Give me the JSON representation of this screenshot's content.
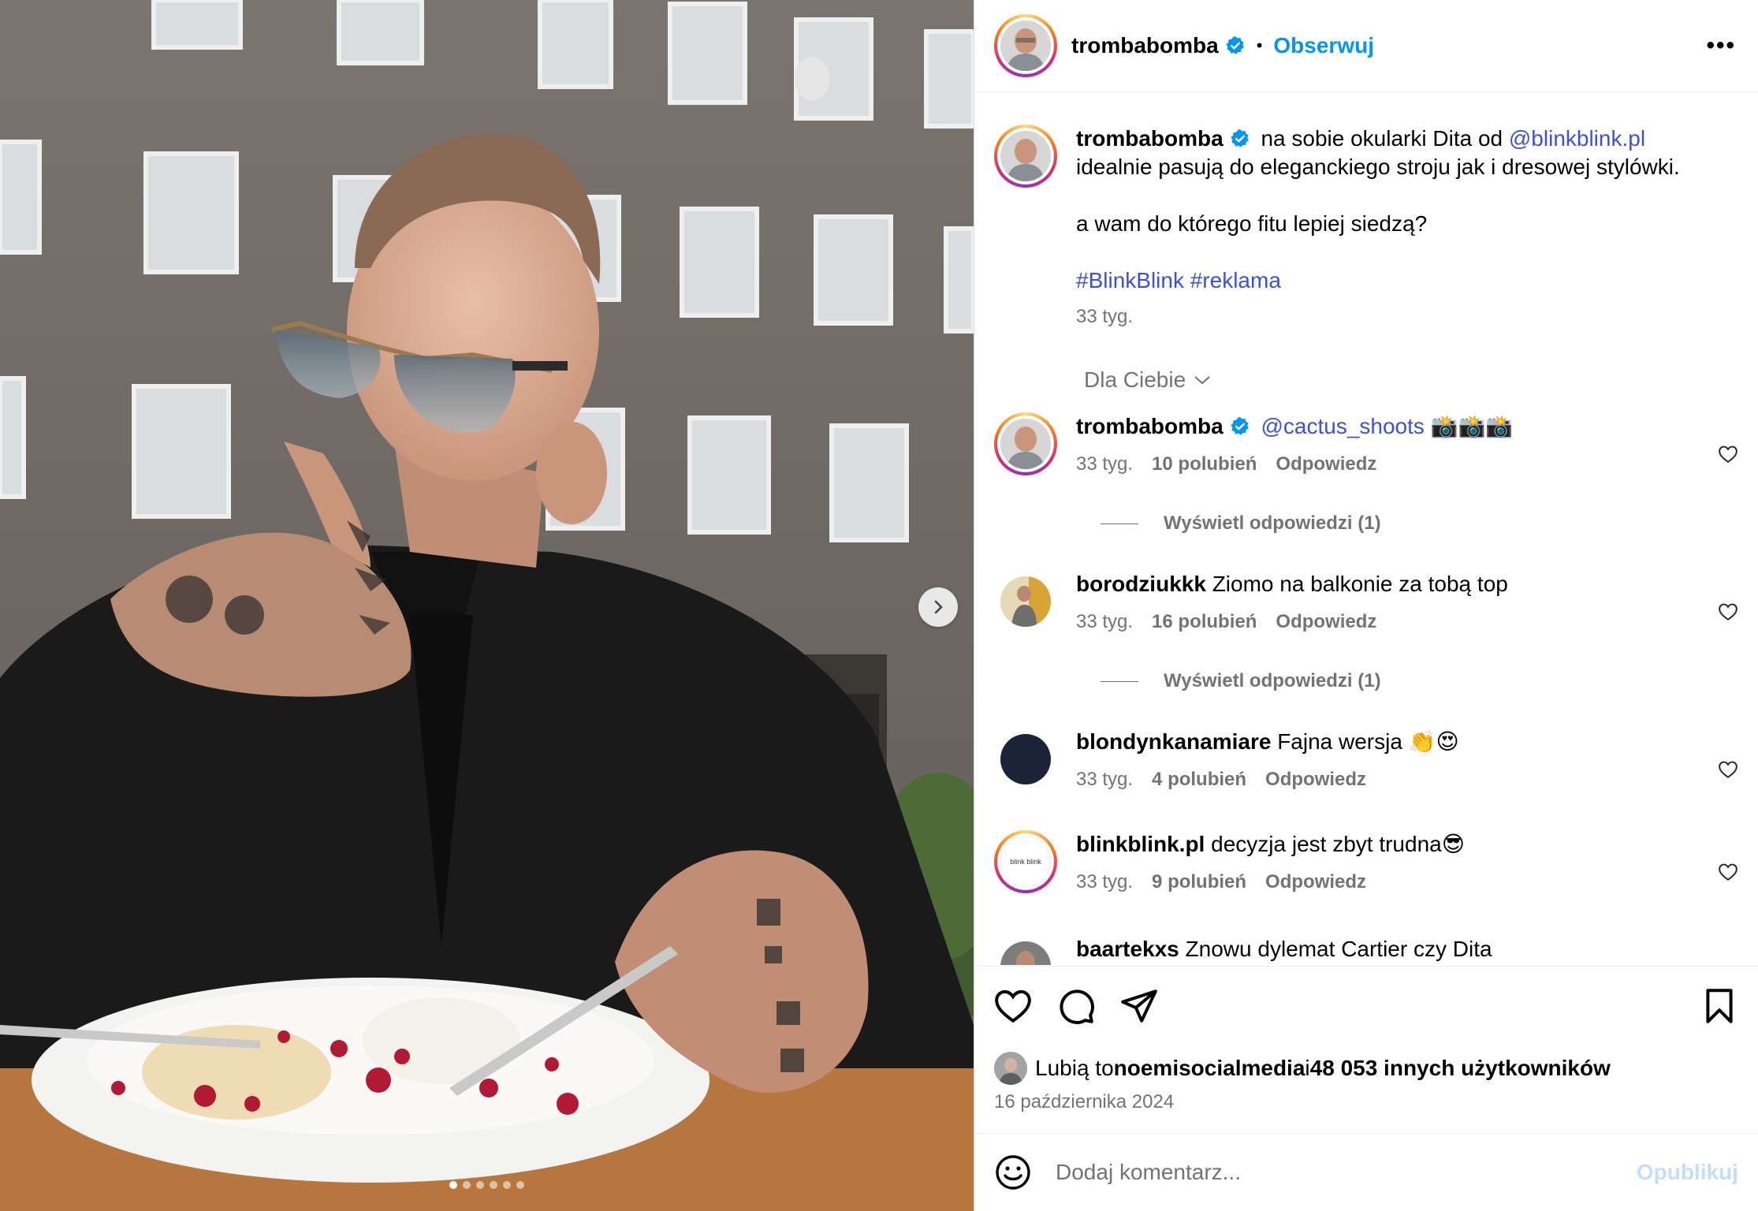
{
  "post": {
    "author": "trombabomba",
    "follow_label": "Obserwuj",
    "bullet": "•",
    "more_label": "•••",
    "media_dots": 6,
    "active_dot": 0
  },
  "caption": {
    "author": "trombabomba",
    "line1": "na sobie okularki Dita od ",
    "mention": "@blinkblink.pl",
    "line2": "idealnie pasują do eleganckiego stroju jak i dresowej stylówki.",
    "line3": "a wam do którego fitu lepiej siedzą?",
    "hashtag1": "#BlinkBlink",
    "hashtag2": "#reklama",
    "time": "33 tyg."
  },
  "filter_label": "Dla Ciebie",
  "comments": [
    {
      "user": "trombabomba",
      "mention": "@cactus_shoots",
      "text": " 📸📸📸",
      "time": "33 tyg.",
      "likes": "10 polubień",
      "reply": "Odpowiedz",
      "view_replies": "Wyświetl odpowiedzi (1)"
    },
    {
      "user": "borodziukkk",
      "text": "Ziomo na balkonie za tobą top",
      "time": "33 tyg.",
      "likes": "16 polubień",
      "reply": "Odpowiedz",
      "view_replies": "Wyświetl odpowiedzi (1)"
    },
    {
      "user": "blondynkanamiare",
      "text": "Fajna wersja 👏😍",
      "time": "33 tyg.",
      "likes": "4 polubień",
      "reply": "Odpowiedz"
    },
    {
      "user": "blinkblink.pl",
      "text": "decyzja jest zbyt trudna😎",
      "time": "33 tyg.",
      "likes": "9 polubień",
      "reply": "Odpowiedz",
      "avatar_text": "blink blink"
    },
    {
      "user": "baartekxs",
      "text": "Znowu dylemat Cartier czy Dita"
    }
  ],
  "likes_line": {
    "prefix": "Lubią to ",
    "user": "noemisocialmedia",
    "middle": " i ",
    "count": "48 053 innych użytkowników"
  },
  "date": "16 października 2024",
  "comment_box": {
    "placeholder": "Dodaj komentarz...",
    "publish_label": "Opublikuj"
  },
  "colors": {
    "link_blue": "#0095f6",
    "mention_blue": "#3c50e0",
    "muted": "#737373",
    "publish_disabled": "#c0dffd"
  }
}
